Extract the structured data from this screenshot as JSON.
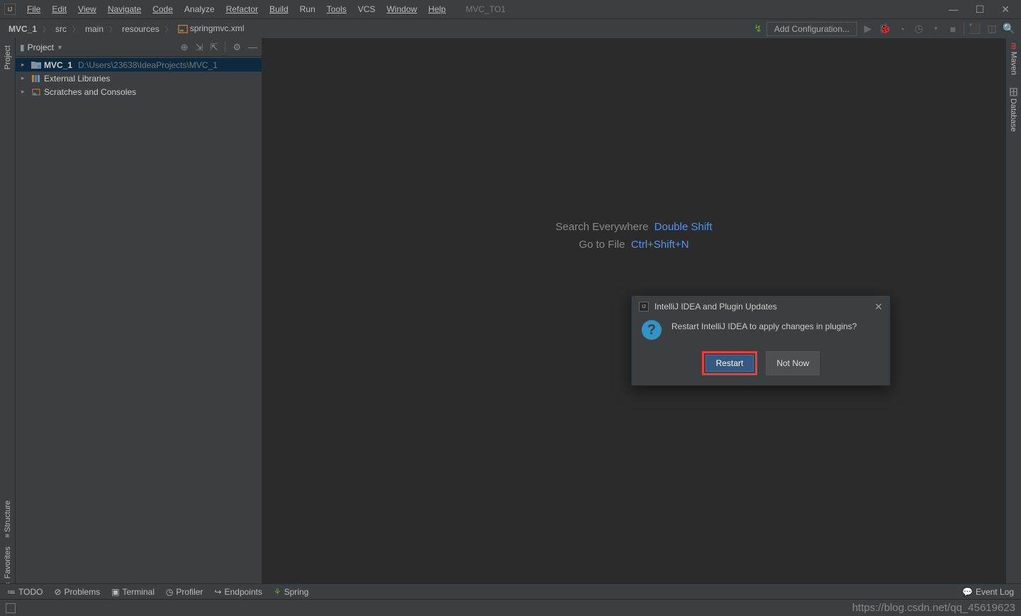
{
  "title_project": "MVC_TO1",
  "menus": [
    "File",
    "Edit",
    "View",
    "Navigate",
    "Code",
    "Analyze",
    "Refactor",
    "Build",
    "Run",
    "Tools",
    "VCS",
    "Window",
    "Help"
  ],
  "breadcrumbs": [
    "MVC_1",
    "src",
    "main",
    "resources",
    "springmvc.xml"
  ],
  "run_config_label": "Add Configuration...",
  "project_panel": {
    "title": "Project",
    "root_name": "MVC_1",
    "root_path": "D:\\Users\\23638\\IdeaProjects\\MVC_1",
    "ext_lib": "External Libraries",
    "scratches": "Scratches and Consoles"
  },
  "hints": {
    "l1_label": "Search Everywhere",
    "l1_key": "Double Shift",
    "l2_label": "Go to File",
    "l2_key": "Ctrl+Shift+N"
  },
  "dialog": {
    "title": "IntelliJ IDEA and Plugin Updates",
    "message": "Restart IntelliJ IDEA to apply changes in plugins?",
    "btn_primary": "Restart",
    "btn_secondary": "Not Now"
  },
  "left_tabs": {
    "project": "Project",
    "structure": "Structure",
    "favorites": "Favorites"
  },
  "right_tabs": {
    "maven": "Maven",
    "database": "Database"
  },
  "bottom_tabs": {
    "todo": "TODO",
    "problems": "Problems",
    "terminal": "Terminal",
    "profiler": "Profiler",
    "endpoints": "Endpoints",
    "spring": "Spring",
    "eventlog": "Event Log"
  },
  "watermark": "https://blog.csdn.net/qq_45619623"
}
